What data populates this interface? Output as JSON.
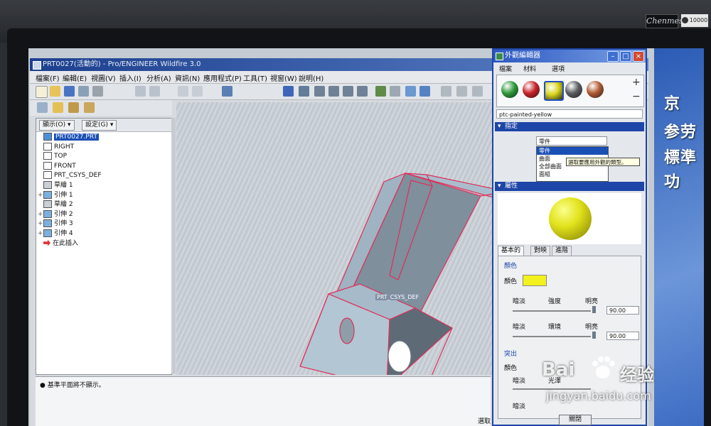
{
  "monitor": {
    "brand": "Chenmes",
    "badge": "10000"
  },
  "desktop_text": [
    "京",
    "参劳",
    "標準",
    "功"
  ],
  "main_window": {
    "title": "PRT0027(活動的) - Pro/ENGINEER Wildfire 3.0",
    "menu": [
      "檔案(F)",
      "編輯(E)",
      "視圖(V)",
      "插入(I)",
      "分析(A)",
      "資訊(N)",
      "應用程式(P)",
      "工具(T)",
      "視窗(W)",
      "說明(H)"
    ],
    "tree_header": {
      "show_label": "顯示(O) ▾",
      "settings_label": "設定(G) ▾"
    },
    "tree": [
      {
        "label": "PRT0027.PRT",
        "icon": "part-icon",
        "expand": ""
      },
      {
        "label": "RIGHT",
        "icon": "datum-plane-icon",
        "expand": ""
      },
      {
        "label": "TOP",
        "icon": "datum-plane-icon",
        "expand": ""
      },
      {
        "label": "FRONT",
        "icon": "datum-plane-icon",
        "expand": ""
      },
      {
        "label": "PRT_CSYS_DEF",
        "icon": "csys-icon",
        "expand": ""
      },
      {
        "label": "草繪 1",
        "icon": "sketch-icon",
        "expand": ""
      },
      {
        "label": "引伸 1",
        "icon": "extrude-icon",
        "expand": "+"
      },
      {
        "label": "草繪 2",
        "icon": "sketch-icon",
        "expand": ""
      },
      {
        "label": "引伸 2",
        "icon": "extrude-icon",
        "expand": "+"
      },
      {
        "label": "引伸 3",
        "icon": "extrude-icon",
        "expand": "+"
      },
      {
        "label": "引伸 4",
        "icon": "extrude-icon",
        "expand": "+"
      },
      {
        "label": "在此插入",
        "icon": "insert-arrow-icon",
        "expand": ""
      }
    ],
    "message": "● 基準平面將不顯示。",
    "status_filter": "選取 ▾",
    "model_label": "PRT_CSYS_DEF"
  },
  "appearance_editor": {
    "title": "外觀編輯器",
    "menu": [
      "檔案",
      "材料",
      "選項"
    ],
    "swatches": [
      "#2e9a3b",
      "#c8232a",
      "#d8d51c",
      "#5b5d61",
      "#b05a32"
    ],
    "material_name": "ptc-painted-yellow",
    "assign_section": "指定",
    "assign_current": "零件",
    "assign_options": [
      "零件",
      "曲面",
      "全部曲面",
      "面組"
    ],
    "tooltip": "選取要應用外觀的類型。",
    "properties_section": "屬性",
    "tabs": [
      "基本的",
      "對映",
      "進階"
    ],
    "color_group": "顏色",
    "color_label": "顏色",
    "dim_label": "暗淡",
    "intensity_label": "強度",
    "bright_label": "明亮",
    "ambient_label": "環境",
    "intensity_value": "90.00",
    "ambient_value": "90.00",
    "highlight_group": "突出",
    "highlight_color_label": "顏色",
    "shine_dim_label": "暗淡",
    "shine_label": "光澤",
    "dim2_label": "暗淡",
    "close_label": "關閉"
  },
  "watermark": {
    "logo": "Bai",
    "cn": "经验",
    "url": "jingyan.baidu.com"
  }
}
